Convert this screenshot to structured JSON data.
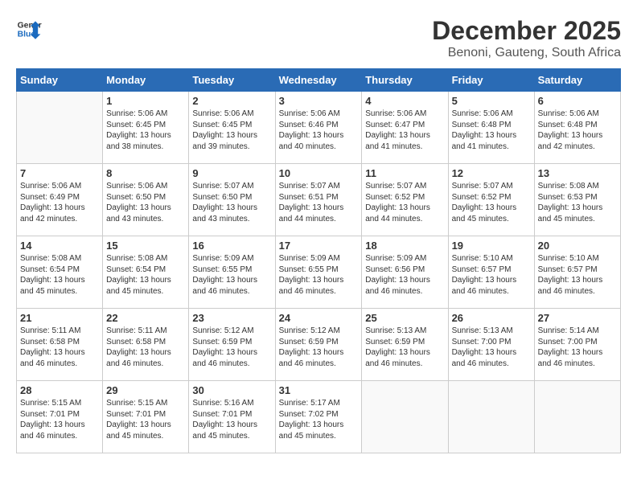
{
  "header": {
    "logo_line1": "General",
    "logo_line2": "Blue",
    "month": "December 2025",
    "location": "Benoni, Gauteng, South Africa"
  },
  "days_of_week": [
    "Sunday",
    "Monday",
    "Tuesday",
    "Wednesday",
    "Thursday",
    "Friday",
    "Saturday"
  ],
  "weeks": [
    [
      {
        "day": "",
        "info": ""
      },
      {
        "day": "1",
        "info": "Sunrise: 5:06 AM\nSunset: 6:45 PM\nDaylight: 13 hours\nand 38 minutes."
      },
      {
        "day": "2",
        "info": "Sunrise: 5:06 AM\nSunset: 6:45 PM\nDaylight: 13 hours\nand 39 minutes."
      },
      {
        "day": "3",
        "info": "Sunrise: 5:06 AM\nSunset: 6:46 PM\nDaylight: 13 hours\nand 40 minutes."
      },
      {
        "day": "4",
        "info": "Sunrise: 5:06 AM\nSunset: 6:47 PM\nDaylight: 13 hours\nand 41 minutes."
      },
      {
        "day": "5",
        "info": "Sunrise: 5:06 AM\nSunset: 6:48 PM\nDaylight: 13 hours\nand 41 minutes."
      },
      {
        "day": "6",
        "info": "Sunrise: 5:06 AM\nSunset: 6:48 PM\nDaylight: 13 hours\nand 42 minutes."
      }
    ],
    [
      {
        "day": "7",
        "info": "Sunrise: 5:06 AM\nSunset: 6:49 PM\nDaylight: 13 hours\nand 42 minutes."
      },
      {
        "day": "8",
        "info": "Sunrise: 5:06 AM\nSunset: 6:50 PM\nDaylight: 13 hours\nand 43 minutes."
      },
      {
        "day": "9",
        "info": "Sunrise: 5:07 AM\nSunset: 6:50 PM\nDaylight: 13 hours\nand 43 minutes."
      },
      {
        "day": "10",
        "info": "Sunrise: 5:07 AM\nSunset: 6:51 PM\nDaylight: 13 hours\nand 44 minutes."
      },
      {
        "day": "11",
        "info": "Sunrise: 5:07 AM\nSunset: 6:52 PM\nDaylight: 13 hours\nand 44 minutes."
      },
      {
        "day": "12",
        "info": "Sunrise: 5:07 AM\nSunset: 6:52 PM\nDaylight: 13 hours\nand 45 minutes."
      },
      {
        "day": "13",
        "info": "Sunrise: 5:08 AM\nSunset: 6:53 PM\nDaylight: 13 hours\nand 45 minutes."
      }
    ],
    [
      {
        "day": "14",
        "info": "Sunrise: 5:08 AM\nSunset: 6:54 PM\nDaylight: 13 hours\nand 45 minutes."
      },
      {
        "day": "15",
        "info": "Sunrise: 5:08 AM\nSunset: 6:54 PM\nDaylight: 13 hours\nand 45 minutes."
      },
      {
        "day": "16",
        "info": "Sunrise: 5:09 AM\nSunset: 6:55 PM\nDaylight: 13 hours\nand 46 minutes."
      },
      {
        "day": "17",
        "info": "Sunrise: 5:09 AM\nSunset: 6:55 PM\nDaylight: 13 hours\nand 46 minutes."
      },
      {
        "day": "18",
        "info": "Sunrise: 5:09 AM\nSunset: 6:56 PM\nDaylight: 13 hours\nand 46 minutes."
      },
      {
        "day": "19",
        "info": "Sunrise: 5:10 AM\nSunset: 6:57 PM\nDaylight: 13 hours\nand 46 minutes."
      },
      {
        "day": "20",
        "info": "Sunrise: 5:10 AM\nSunset: 6:57 PM\nDaylight: 13 hours\nand 46 minutes."
      }
    ],
    [
      {
        "day": "21",
        "info": "Sunrise: 5:11 AM\nSunset: 6:58 PM\nDaylight: 13 hours\nand 46 minutes."
      },
      {
        "day": "22",
        "info": "Sunrise: 5:11 AM\nSunset: 6:58 PM\nDaylight: 13 hours\nand 46 minutes."
      },
      {
        "day": "23",
        "info": "Sunrise: 5:12 AM\nSunset: 6:59 PM\nDaylight: 13 hours\nand 46 minutes."
      },
      {
        "day": "24",
        "info": "Sunrise: 5:12 AM\nSunset: 6:59 PM\nDaylight: 13 hours\nand 46 minutes."
      },
      {
        "day": "25",
        "info": "Sunrise: 5:13 AM\nSunset: 6:59 PM\nDaylight: 13 hours\nand 46 minutes."
      },
      {
        "day": "26",
        "info": "Sunrise: 5:13 AM\nSunset: 7:00 PM\nDaylight: 13 hours\nand 46 minutes."
      },
      {
        "day": "27",
        "info": "Sunrise: 5:14 AM\nSunset: 7:00 PM\nDaylight: 13 hours\nand 46 minutes."
      }
    ],
    [
      {
        "day": "28",
        "info": "Sunrise: 5:15 AM\nSunset: 7:01 PM\nDaylight: 13 hours\nand 46 minutes."
      },
      {
        "day": "29",
        "info": "Sunrise: 5:15 AM\nSunset: 7:01 PM\nDaylight: 13 hours\nand 45 minutes."
      },
      {
        "day": "30",
        "info": "Sunrise: 5:16 AM\nSunset: 7:01 PM\nDaylight: 13 hours\nand 45 minutes."
      },
      {
        "day": "31",
        "info": "Sunrise: 5:17 AM\nSunset: 7:02 PM\nDaylight: 13 hours\nand 45 minutes."
      },
      {
        "day": "",
        "info": ""
      },
      {
        "day": "",
        "info": ""
      },
      {
        "day": "",
        "info": ""
      }
    ]
  ]
}
